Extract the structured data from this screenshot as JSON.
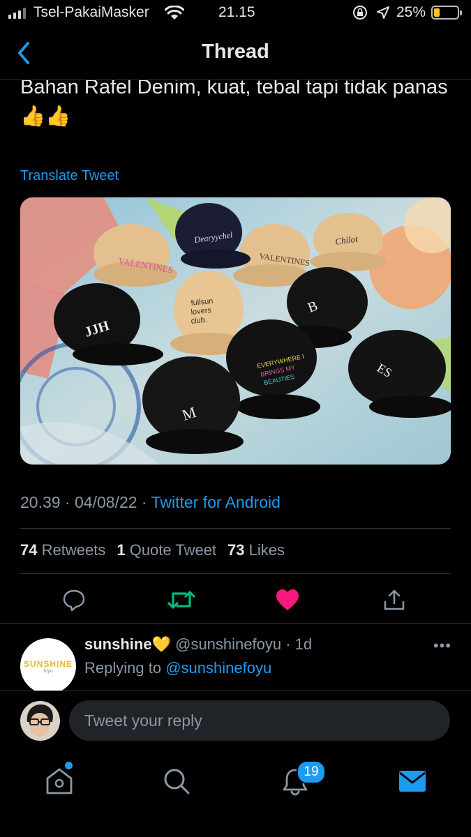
{
  "status_bar": {
    "carrier": "Tsel-PakaiMasker",
    "time": "21.15",
    "battery_percent": "25%",
    "battery_level": 0.25
  },
  "nav": {
    "title": "Thread",
    "back_icon": "chevron-left-icon"
  },
  "tweet": {
    "text": "Bahan Rafel Denim, kuat, tebal tapi tidak panas 👍👍",
    "translate_label": "Translate Tweet",
    "time": "20.39",
    "date": "04/08/22",
    "source": "Twitter for Android",
    "stats": {
      "retweets_count": "74",
      "retweets_label": "Retweets",
      "quotes_count": "1",
      "quotes_label": "Quote Tweet",
      "likes_count": "73",
      "likes_label": "Likes"
    },
    "actions": {
      "reply_icon": "reply-icon",
      "retweet_icon": "retweet-icon",
      "like_icon": "heart-icon",
      "share_icon": "share-icon",
      "retweet_color": "#00ba7c",
      "like_color": "#f91880"
    }
  },
  "reply_tweet": {
    "name": "sunshine",
    "emoji": "💛",
    "handle": "@sunshinefoyu",
    "age": "1d",
    "replying_prefix": "Replying to",
    "replying_handle": "@sunshinefoyu",
    "avatar_text": "SUNSHINE",
    "avatar_subtext": "foyu"
  },
  "composer": {
    "placeholder": "Tweet your reply"
  },
  "tabbar": {
    "home_icon": "home-icon",
    "search_icon": "search-icon",
    "notifications_icon": "bell-icon",
    "notifications_badge": "19",
    "messages_icon": "mail-icon",
    "accent": "#1d9bf0"
  }
}
